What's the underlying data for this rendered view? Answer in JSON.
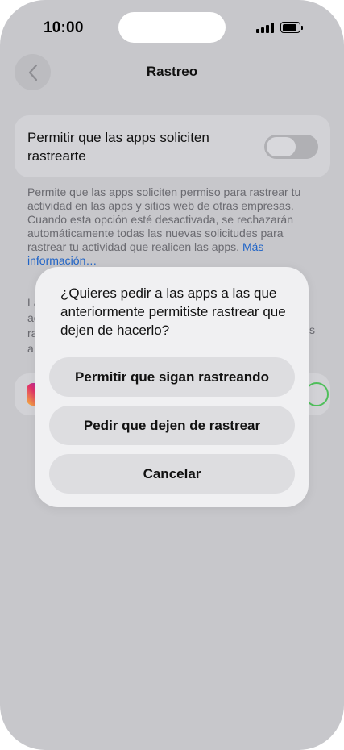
{
  "status_bar": {
    "time": "10:00"
  },
  "nav": {
    "back_icon": "chevron-left-icon",
    "title": "Rastreo"
  },
  "tracking_setting": {
    "label": "Permitir que las apps soliciten rastrearte",
    "enabled": false
  },
  "description": {
    "text": "Permite que las apps soliciten permiso para rastrear tu actividad en las apps y sitios web de otras empresas. Cuando esta opción esté desactivada, se rechazarán automáticamente todas las nuevas solicitudes para rastrear tu actividad que realicen las apps.",
    "link": "Más información…"
  },
  "obscured_text": {
    "left": "La\nac\nra\na",
    "right": "s"
  },
  "app_list": {
    "icon": "instagram-icon"
  },
  "dialog": {
    "message": "¿Quieres pedir a las apps a las que anteriormente permitiste rastrear que dejen de hacerlo?",
    "buttons": [
      {
        "label": "Permitir que sigan rastreando"
      },
      {
        "label": "Pedir que dejen de rastrear"
      },
      {
        "label": "Cancelar"
      }
    ]
  },
  "colors": {
    "overlay_background": "#c7c7cb",
    "dialog_background": "#f0f0f2",
    "link": "#1e63c7",
    "toggle_on": "#4fbf5b"
  }
}
